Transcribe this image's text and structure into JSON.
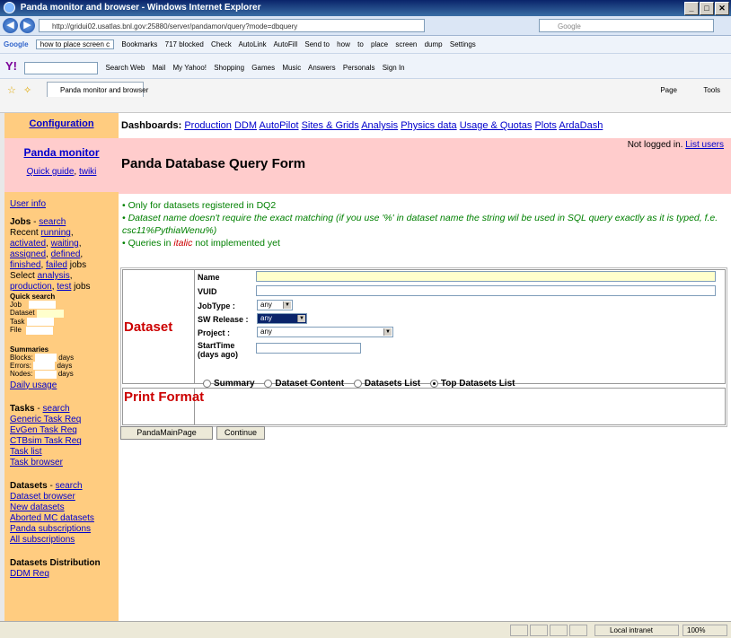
{
  "browser": {
    "title": "Panda monitor and browser - Windows Internet Explorer",
    "url": "http://gridui02.usatlas.bnl.gov:25880/server/pandamon/query?mode=dbquery",
    "search_placeholder": "Google",
    "tab_title": "Panda monitor and browser",
    "google_search_text": "how to place screen c",
    "toolbar_google": [
      "Bookmarks",
      "717 blocked",
      "Check",
      "AutoLink",
      "AutoFill",
      "Send to",
      "how",
      "to",
      "place",
      "screen",
      "dump",
      "Settings"
    ],
    "toolbar_yahoo": [
      "Search Web",
      "Mail",
      "My Yahoo!",
      "Shopping",
      "Games",
      "Music",
      "Answers",
      "Personals",
      "Sign In"
    ],
    "command_bar": [
      "Page",
      "Tools"
    ],
    "status_zone": "Local intranet",
    "zoom": "100%"
  },
  "sidebar": {
    "configuration": "Configuration",
    "panda_monitor": "Panda monitor",
    "quick_guide": "Quick guide",
    "twiki": "twiki",
    "user_info": "User info",
    "jobs_label": "Jobs",
    "search": "search",
    "recent": "Recent",
    "running": "running",
    "activated": "activated",
    "waiting": "waiting",
    "assigned": "assigned",
    "defined": "defined",
    "finished": "finished",
    "failed": "failed",
    "jobs_word": "jobs",
    "select": "Select",
    "analysis": "analysis",
    "production": "production",
    "test": "test",
    "quick_search": "Quick search",
    "qs_job": "Job",
    "qs_dataset": "Dataset",
    "qs_task": "Task",
    "qs_file": "File",
    "summaries": "Summaries",
    "blocks": "Blocks:",
    "errors": "Errors:",
    "nodes": "Nodes:",
    "days": "days",
    "daily_usage": "Daily usage",
    "tasks_label": "Tasks",
    "task_links": [
      "Generic Task Req",
      "EvGen Task Req",
      "CTBsim Task Req",
      "Task list",
      "Task browser"
    ],
    "datasets_label": "Datasets",
    "dataset_links": [
      "Dataset browser",
      "New datasets",
      "Aborted MC datasets",
      "Panda subscriptions",
      "All subscriptions"
    ],
    "datasets_distribution": "Datasets Distribution",
    "ddm_req": "DDM Req"
  },
  "dashboards": {
    "label": "Dashboards:",
    "links": [
      "Production",
      "DDM",
      "AutoPilot",
      "Sites & Grids",
      "Analysis",
      "Physics data",
      "Usage & Quotas",
      "Plots",
      "ArdaDash"
    ]
  },
  "header": {
    "login_status": "Not logged in.",
    "list_users": "List users",
    "title": "Panda Database Query Form"
  },
  "notes": {
    "n1": "Only for datasets registered in DQ2",
    "n2": "Dataset name doesn't require the exact matching (if you use '%' in dataset name the string wil be used in SQL query exactly as it is typed, f.e. csc11%PythiaWenu%)",
    "n3_prefix": "Queries in",
    "n3_italic": "italic",
    "n3_suffix": "not implemented yet"
  },
  "form": {
    "section_dataset": "Dataset",
    "name_label": "Name",
    "vuid_label": "VUID",
    "jobtype_label": "JobType :",
    "jobtype_value": "any",
    "swrelease_label": "SW Release :",
    "swrelease_value": "any",
    "project_label": "Project :",
    "project_value": "any",
    "starttime_label": "StartTime",
    "starttime_sub": "(days ago)",
    "section_print": "Print Format",
    "print_options": [
      "Summary",
      "Dataset Content",
      "Datasets List",
      "Top Datasets List"
    ],
    "print_selected": "Top Datasets List"
  },
  "buttons": {
    "main_page": "PandaMainPage",
    "continue": "Continue"
  },
  "colors": {
    "sidebar": "#ffcc80",
    "header": "#ffcccc",
    "label_red": "#cc0000",
    "note_green": "#008000",
    "link": "#0000cc"
  }
}
